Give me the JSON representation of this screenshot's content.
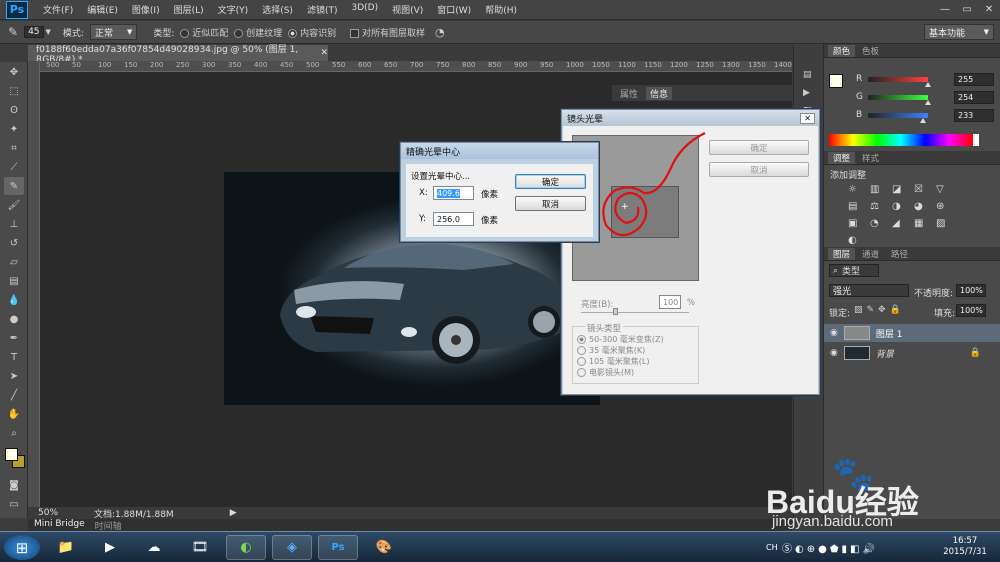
{
  "app": {
    "logo": "Ps",
    "window_controls": [
      "—",
      "▭",
      "✕"
    ]
  },
  "menu": [
    "文件(F)",
    "编辑(E)",
    "图像(I)",
    "图层(L)",
    "文字(Y)",
    "选择(S)",
    "滤镜(T)",
    "3D(D)",
    "视图(V)",
    "窗口(W)",
    "帮助(H)"
  ],
  "options": {
    "brush_size": "45",
    "mode_label": "模式:",
    "mode_value": "正常",
    "type_label": "类型:",
    "type_options": [
      "近似匹配",
      "创建纹理",
      "内容识别"
    ],
    "type_selected": "内容识别",
    "sample_all": "对所有图层取样",
    "workspace": "基本功能"
  },
  "document": {
    "tab_title": "f0188f60edda07a36f07854d49028934.jpg @ 50% (图层 1, RGB/8#) *",
    "ruler_ticks": [
      "500",
      "50",
      "100",
      "150",
      "200",
      "250",
      "300",
      "350",
      "400",
      "450",
      "500",
      "550",
      "600",
      "650",
      "700",
      "750",
      "800",
      "850",
      "900",
      "950",
      "1000",
      "1050",
      "1100",
      "1150",
      "1200",
      "1250",
      "1300",
      "1350",
      "1400",
      "145"
    ],
    "zoom": "50%",
    "doc_size": "文档:1.88M/1.88M"
  },
  "bottom_tabs": [
    "Mini Bridge",
    "时间轴"
  ],
  "lens_flare": {
    "title": "镜头光晕",
    "ok": "确定",
    "cancel": "取消",
    "brightness_label": "亮度(B):",
    "brightness_value": "100",
    "brightness_unit": "%",
    "lens_type_label": "镜头类型",
    "lens_types": [
      "50-300 毫米变焦(Z)",
      "35 毫米聚焦(K)",
      "105 毫米聚焦(L)",
      "电影镜头(M)"
    ],
    "lens_selected": "50-300 毫米变焦(Z)"
  },
  "center_dialog": {
    "title": "精确光晕中心",
    "prompt": "设置光晕中心...",
    "x_label": "X:",
    "x_value": "409.6",
    "y_label": "Y:",
    "y_value": "256.0",
    "unit": "像素",
    "ok": "确定",
    "cancel": "取消"
  },
  "info_panel": {
    "tabs": [
      "属性",
      "信息"
    ]
  },
  "color_panel": {
    "tabs": [
      "颜色",
      "色板"
    ],
    "channels": [
      {
        "name": "R",
        "value": "255",
        "color": "#ff4040"
      },
      {
        "name": "G",
        "value": "254",
        "color": "#40ff40"
      },
      {
        "name": "B",
        "value": "233",
        "color": "#4080ff"
      }
    ]
  },
  "adjust_panel": {
    "tabs": [
      "调整",
      "样式"
    ],
    "heading": "添加调整"
  },
  "layers_panel": {
    "tabs": [
      "图层",
      "通道",
      "路径"
    ],
    "filter": "类型",
    "blend_mode": "强光",
    "opacity_label": "不透明度:",
    "opacity": "100%",
    "lock_label": "锁定:",
    "fill_label": "填充:",
    "fill": "100%",
    "layers": [
      {
        "name": "图层 1",
        "selected": true
      },
      {
        "name": "背景",
        "selected": false
      }
    ]
  },
  "taskbar": {
    "time": "16:57",
    "date": "2015/7/31",
    "lang": "CH"
  },
  "watermark": {
    "brand": "Baidu经验",
    "url": "jingyan.baidu.com"
  }
}
